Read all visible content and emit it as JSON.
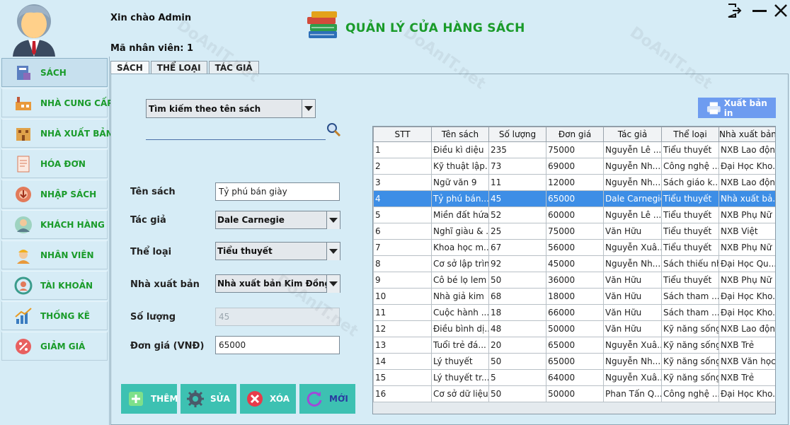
{
  "header": {
    "greeting": "Xin chào Admin",
    "staff_id": "Mã nhân viên: 1",
    "app_title": "QUẢN LÝ CỬA HÀNG SÁCH"
  },
  "sidebar": {
    "items": [
      {
        "label": "SÁCH",
        "icon": "book-icon"
      },
      {
        "label": "NHÀ CUNG CẤP",
        "icon": "factory-icon"
      },
      {
        "label": "NHÀ XUẤT BẢN",
        "icon": "building-icon"
      },
      {
        "label": "HÓA ĐƠN",
        "icon": "invoice-icon"
      },
      {
        "label": "NHẬP SÁCH",
        "icon": "import-icon"
      },
      {
        "label": "KHÁCH HÀNG",
        "icon": "customer-icon"
      },
      {
        "label": "NHÂN VIÊN",
        "icon": "employee-icon"
      },
      {
        "label": "TÀI KHOẢN",
        "icon": "account-icon"
      },
      {
        "label": "THỐNG KÊ",
        "icon": "chart-icon"
      },
      {
        "label": "GIẢM GIÁ",
        "icon": "discount-icon"
      }
    ]
  },
  "tabs": [
    "SÁCH",
    "THỂ LOẠI",
    "TÁC GIẢ"
  ],
  "search": {
    "mode": "Tìm kiếm theo tên sách",
    "value": ""
  },
  "form": {
    "title_label": "Tên sách",
    "title_value": "Tỷ phú bán giày",
    "author_label": "Tác giả",
    "author_value": "Dale Carnegie",
    "genre_label": "Thể loại",
    "genre_value": "Tiểu thuyết",
    "publisher_label": "Nhà xuất bản",
    "publisher_value": "Nhà xuất bản Kim Đồng",
    "qty_label": "Số lượng",
    "qty_value": "45",
    "price_label": "Đơn giá (VNĐ)",
    "price_value": "65000"
  },
  "actions": {
    "add": "THÊM",
    "edit": "SỬA",
    "delete": "XÓA",
    "new": "MỚI",
    "print": "Xuất bản in"
  },
  "table": {
    "columns": [
      "STT",
      "Tên sách",
      "Số lượng",
      "Đơn giá",
      "Tác giả",
      "Thể loại",
      "Nhà xuất bản"
    ],
    "selected_index": 3,
    "rows": [
      [
        "1",
        "Điều kì diệu",
        "235",
        "75000",
        "Nguyễn Lê ...",
        "Tiểu thuyết",
        "NXB Lao động"
      ],
      [
        "2",
        "Kỹ thuật lập...",
        "73",
        "69000",
        "Nguyễn Nh...",
        "Công nghệ ...",
        "Đại Học Kho..."
      ],
      [
        "3",
        "Ngữ văn 9",
        "11",
        "12000",
        "Nguyễn Nh...",
        "Sách giáo k...",
        "NXB Lao động"
      ],
      [
        "4",
        "Tỷ phú bán...",
        "45",
        "65000",
        "Dale Carnegie",
        "Tiểu thuyết",
        "Nhà xuất bả..."
      ],
      [
        "5",
        "Miền đất hứa",
        "52",
        "60000",
        "Nguyễn Lê ...",
        "Tiểu thuyết",
        "NXB Phụ Nữ"
      ],
      [
        "6",
        "Nghĩ giàu & ...",
        "25",
        "75000",
        "Văn Hữu",
        "Tiểu thuyết",
        "NXB Việt"
      ],
      [
        "7",
        "Khoa học m...",
        "67",
        "56000",
        "Nguyễn Xuâ...",
        "Tiểu thuyết",
        "NXB Phụ Nữ"
      ],
      [
        "8",
        "Cơ sở lập trình",
        "92",
        "45000",
        "Nguyễn Nh...",
        "Sách thiếu nhi",
        "Đại Học Qu..."
      ],
      [
        "9",
        "Cô bé lọ lem",
        "50",
        "36000",
        "Văn Hữu",
        "Tiểu thuyết",
        "NXB Phụ Nữ"
      ],
      [
        "10",
        "Nhà giả kim",
        "68",
        "18000",
        "Văn Hữu",
        "Sách tham ...",
        "Đại Học Kho..."
      ],
      [
        "11",
        "Cuộc hành ...",
        "18",
        "66000",
        "Văn Hữu",
        "Sách tham ...",
        "Đại Học Kho..."
      ],
      [
        "12",
        "Điều bình dị...",
        "48",
        "50000",
        "Văn Hữu",
        "Kỹ năng sống",
        "NXB Lao động"
      ],
      [
        "13",
        "Tuổi trẻ đá...",
        "20",
        "65000",
        "Nguyễn Xuâ...",
        "Kỹ năng sống",
        "NXB Trẻ"
      ],
      [
        "14",
        "Lý thuyết",
        "50",
        "65000",
        "Nguyễn Nh...",
        "Kỹ năng sống",
        "NXB Văn học"
      ],
      [
        "15",
        "Lý thuyết tr...",
        "5",
        "64000",
        "Nguyễn Xuâ...",
        "Kỹ năng sống",
        "NXB Trẻ"
      ],
      [
        "16",
        "Cơ sở dữ liệu",
        "50",
        "50000",
        "Phan Tấn Q...",
        "Công nghệ ...",
        "Đại Học Kho..."
      ]
    ]
  },
  "colors": {
    "background": "#d6ecf6",
    "accent_green": "#1a9b2a",
    "action_teal": "#3dc1b2",
    "print_blue": "#6e9cf0",
    "selected_row": "#3d8ee6"
  }
}
